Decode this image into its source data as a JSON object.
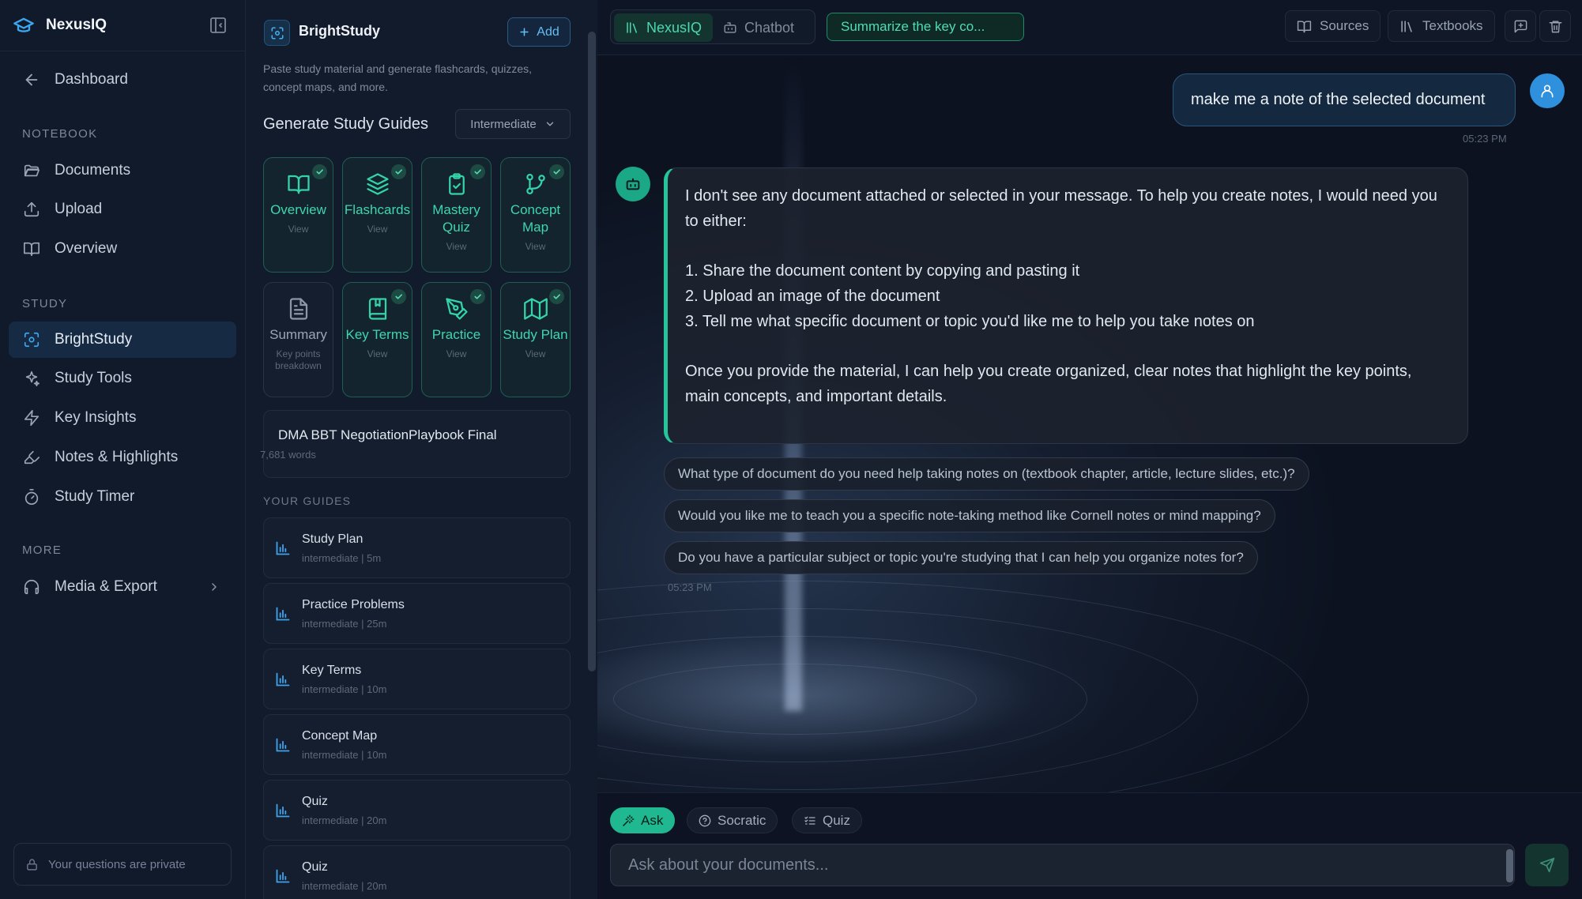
{
  "app": {
    "name": "NexusIQ"
  },
  "sidebar": {
    "back_label": "Dashboard",
    "sections": {
      "notebook": "NOTEBOOK",
      "study": "STUDY",
      "more": "MORE"
    },
    "notebook_items": [
      "Documents",
      "Upload",
      "Overview"
    ],
    "study_items": [
      "BrightStudy",
      "Study Tools",
      "Key Insights",
      "Notes & Highlights",
      "Study Timer"
    ],
    "more_items": [
      "Media & Export"
    ],
    "privacy_note": "Your questions are private"
  },
  "panel": {
    "title": "BrightStudy",
    "add_label": "Add",
    "description": "Paste study material and generate flashcards, quizzes, concept maps, and more.",
    "generate_title": "Generate Study Guides",
    "level": "Intermediate",
    "guide_cards": [
      {
        "label": "Overview",
        "sub": "View",
        "done": true
      },
      {
        "label": "Flashcards",
        "sub": "View",
        "done": true
      },
      {
        "label": "Mastery Quiz",
        "sub": "View",
        "done": true
      },
      {
        "label": "Concept Map",
        "sub": "View",
        "done": true
      },
      {
        "label": "Summary",
        "sub": "Key points breakdown",
        "done": false
      },
      {
        "label": "Key Terms",
        "sub": "View",
        "done": true
      },
      {
        "label": "Practice",
        "sub": "View",
        "done": true
      },
      {
        "label": "Study Plan",
        "sub": "View",
        "done": true
      }
    ],
    "document": {
      "title": "DMA BBT NegotiationPlaybook Final",
      "words": "7,681 words"
    },
    "your_guides_label": "YOUR GUIDES",
    "guides": [
      {
        "title": "Study Plan",
        "meta": "intermediate | 5m"
      },
      {
        "title": "Practice Problems",
        "meta": "intermediate | 25m"
      },
      {
        "title": "Key Terms",
        "meta": "intermediate | 10m"
      },
      {
        "title": "Concept Map",
        "meta": "intermediate | 10m"
      },
      {
        "title": "Quiz",
        "meta": "intermediate | 20m"
      },
      {
        "title": "Quiz",
        "meta": "intermediate | 20m"
      }
    ]
  },
  "chat": {
    "mode_tabs": [
      "NexusIQ",
      "Chatbot"
    ],
    "active_mode": "NexusIQ",
    "prompt_chip": "Summarize the key co...",
    "top_buttons": {
      "sources": "Sources",
      "textbooks": "Textbooks"
    },
    "user_message": {
      "text": "make me a note of the selected document",
      "time": "05:23 PM"
    },
    "bot_message": {
      "intro": "I don't see any document attached or selected in your message. To help you create notes, I would need you to either:",
      "options": [
        "1. Share the document content by copying and pasting it",
        "2. Upload an image of the document",
        "3. Tell me what specific document or topic you'd like me to help you take notes on"
      ],
      "closing": "Once you provide the material, I can help you create organized, clear notes that highlight the key points, main concepts, and important details.",
      "time": "05:23 PM"
    },
    "suggestions": [
      "What type of document do you need help taking notes on (textbook chapter, article, lecture slides, etc.)?",
      "Would you like me to teach you a specific note-taking method like Cornell notes or mind mapping?",
      "Do you have a particular subject or topic you're studying that I can help you organize notes for?"
    ],
    "composer": {
      "tabs": [
        "Ask",
        "Socratic",
        "Quiz"
      ],
      "active_tab": "Ask",
      "value": "",
      "placeholder": "Ask about your documents..."
    }
  },
  "colors": {
    "accent_green": "#25c49a",
    "accent_blue": "#3ba7f0",
    "background": "#0b1220"
  }
}
